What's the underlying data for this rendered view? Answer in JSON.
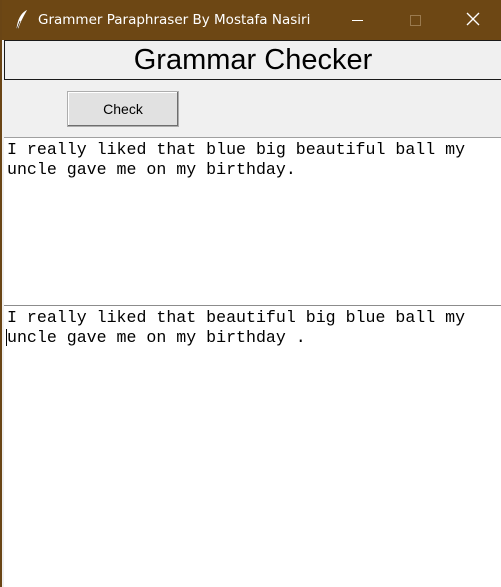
{
  "window": {
    "title": "Grammer Paraphraser By Mostafa Nasiri",
    "icon": "feather-icon",
    "controls": {
      "minimize": "minimize-icon",
      "maximize": "maximize-icon",
      "close": "close-icon"
    },
    "titlebar_color": "#6d4714"
  },
  "header": {
    "title": "Grammar Checker"
  },
  "toolbar": {
    "check_label": "Check"
  },
  "input_text": {
    "lines": [
      "I really liked that blue big beautiful ball my",
      "uncle gave me on my birthday."
    ]
  },
  "output_text": {
    "lines": [
      "I really liked that beautiful big blue ball my",
      "uncle gave me on my birthday ."
    ]
  }
}
